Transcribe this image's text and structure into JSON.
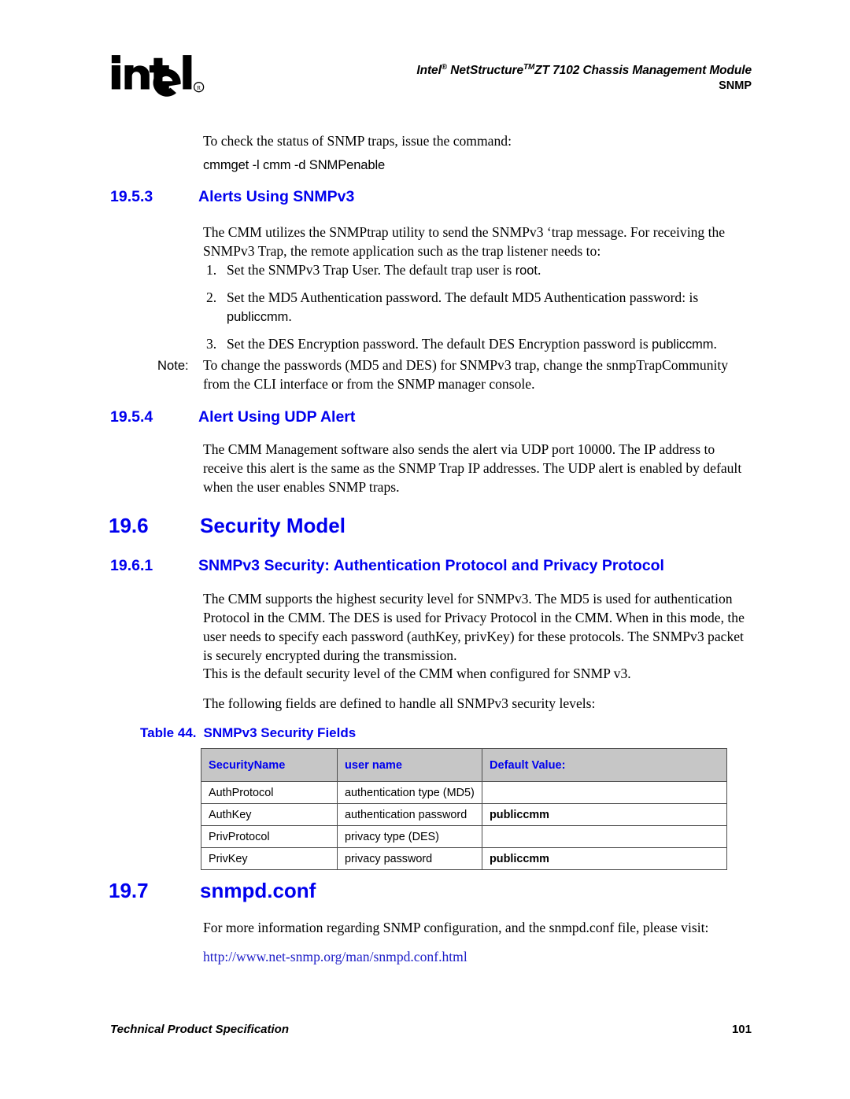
{
  "header": {
    "logo_name": "intel",
    "logo_registered": "®",
    "title_lead": "Intel",
    "title_reg": "®",
    "title_mid": " NetStructure",
    "title_tm": "TM",
    "title_tail": "ZT 7102 Chassis Management Module",
    "subtitle": "SNMP"
  },
  "intro": {
    "line1": "To check the status of SNMP traps, issue the command:",
    "command": "cmmget -l cmm -d SNMPenable"
  },
  "sections": {
    "s1953": {
      "number": "19.5.3",
      "title": "Alerts Using SNMPv3",
      "intro": "The CMM utilizes the SNMPtrap utility to send the SNMPv3 ‘trap  message. For receiving the SNMPv3 Trap, the remote application such as the trap listener needs to:",
      "list": [
        {
          "marker": "1.",
          "text_a": "Set the SNMPv3 Trap User. The default trap user is ",
          "code": "root",
          "text_b": "."
        },
        {
          "marker": "2.",
          "text_a": "Set the MD5 Authentication password. The default MD5 Authentication password: is ",
          "code": "publiccmm",
          "text_b": "."
        },
        {
          "marker": "3.",
          "text_a": "Set the DES Encryption password. The default DES Encryption password is ",
          "code": "publiccmm",
          "text_b": "."
        }
      ],
      "note_label": "Note:",
      "note_text": "To change the passwords (MD5 and DES) for SNMPv3 trap, change the snmpTrapCommunity from the CLI interface or from the SNMP manager console."
    },
    "s1954": {
      "number": "19.5.4",
      "title": "Alert Using UDP Alert",
      "paragraph": "The CMM Management software also sends the alert via UDP port 10000. The IP address to receive this alert is the same as the SNMP Trap IP addresses. The UDP alert is enabled by default when the user enables SNMP traps."
    },
    "s196": {
      "number": "19.6",
      "title": "Security Model"
    },
    "s1961": {
      "number": "19.6.1",
      "title": "SNMPv3 Security: Authentication Protocol and Privacy Protocol",
      "paragraph1": "The CMM supports the highest security level for SNMPv3. The MD5 is used for authentication Protocol in the CMM. The DES is used for Privacy Protocol in the CMM. When in this mode, the user needs to specify each password (authKey, privKey) for these protocols. The SNMPv3 packet is securely encrypted during the transmission.",
      "paragraph2": "This is the default security level of the CMM when configured for SNMP v3.",
      "paragraph3": "The following fields are defined to handle all SNMPv3 security levels:"
    },
    "s197": {
      "number": "19.7",
      "title": "snmpd.conf",
      "paragraph": "For more information regarding SNMP configuration, and the snmpd.conf file, please visit:",
      "url": "http://www.net-snmp.org/man/snmpd.conf.html"
    }
  },
  "table": {
    "caption_label": "Table 44.",
    "caption_title": "SNMPv3 Security Fields",
    "headers": [
      "SecurityName",
      "user name",
      "Default Value:"
    ],
    "rows": [
      {
        "name": "AuthProtocol",
        "desc": "authentication type (MD5)",
        "value": ""
      },
      {
        "name": "AuthKey",
        "desc": "authentication password",
        "value": "publiccmm"
      },
      {
        "name": "PrivProtocol",
        "desc": "privacy type (DES)",
        "value": ""
      },
      {
        "name": "PrivKey",
        "desc": "privacy password",
        "value": "publiccmm"
      }
    ]
  },
  "footer": {
    "left": "Technical Product Specification",
    "page": "101"
  },
  "colors": {
    "heading_blue": "#0000ee",
    "link_blue": "#2020c8",
    "table_header_bg": "#c6c6c6",
    "table_border": "#4c4c4c"
  }
}
